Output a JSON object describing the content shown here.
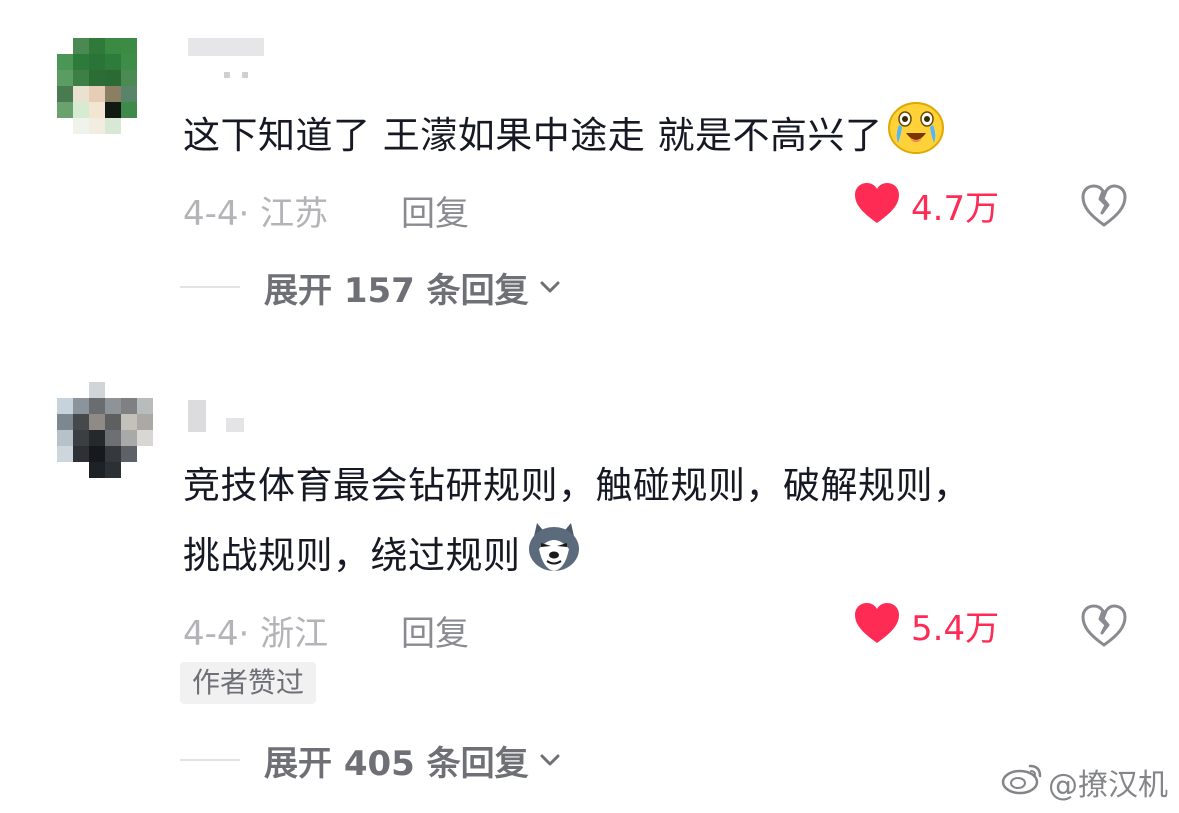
{
  "comments": [
    {
      "text": "这下知道了 王濛如果中途走 就是不高兴了",
      "emoji": "crying-laugh-emoji",
      "date_location": "4-4· 江苏",
      "reply_label": "回复",
      "like_count": "4.7万",
      "expand_label": "展开 157 条回复",
      "avatar_colors": [
        "#ffffff",
        "#4a8a52",
        "#2f7a3b",
        "#3a8a44",
        "#3c8b45",
        "#ffffff",
        "#4c9655",
        "#2d7b3a",
        "#2a7437",
        "#2e7b3c",
        "#3e8c48",
        "#ffffff",
        "#5b9c62",
        "#3d7f45",
        "#2b6d34",
        "#2c6a33",
        "#4b8a52",
        "#ffffff",
        "#4a7a4f",
        "#e9e2d1",
        "#e7cdb5",
        "#8b7f63",
        "#58856a",
        "#ffffff",
        "#6aa26f",
        "#d9ead2",
        "#f2e6d3",
        "#111a12",
        "#3f8a4a",
        "#ffffff",
        "#ffffff",
        "#eef4ec",
        "#f3ece0",
        "#d8e8d4",
        "#ffffff",
        "#ffffff"
      ]
    },
    {
      "text_line1": "竞技体育最会钻研规则，触碰规则，破解规则，",
      "text_line2": "挑战规则，绕过规则",
      "emoji": "husky-dog-emoji",
      "date_location": "4-4· 浙江",
      "reply_label": "回复",
      "like_count": "5.4万",
      "author_badge": "作者赞过",
      "expand_label": "展开 405 条回复",
      "avatar_colors": [
        "#ffffff",
        "#ffffff",
        "#d0d6d8",
        "#ffffff",
        "#ffffff",
        "#ffffff",
        "#c7d3dc",
        "#8b949c",
        "#6a6d70",
        "#8d9396",
        "#7f8082",
        "#b9bcbd",
        "#7c878f",
        "#46494c",
        "#8f8a86",
        "#5e5f61",
        "#c4c1bb",
        "#aaa9a5",
        "#b7c1c9",
        "#3b3f44",
        "#26292c",
        "#6c7074",
        "#a7aaa8",
        "#d9d7d3",
        "#ced6dd",
        "#2d3136",
        "#161a1e",
        "#35393e",
        "#5d6268",
        "#ffffff",
        "#ffffff",
        "#ffffff",
        "#1e2226",
        "#2b3035",
        "#ffffff",
        "#ffffff"
      ]
    }
  ],
  "watermark": "@撩汉机",
  "colors": {
    "like_red": "#fe2c55",
    "text_primary": "#161823",
    "text_muted": "#b3b3b8",
    "text_secondary": "#6f7075"
  }
}
